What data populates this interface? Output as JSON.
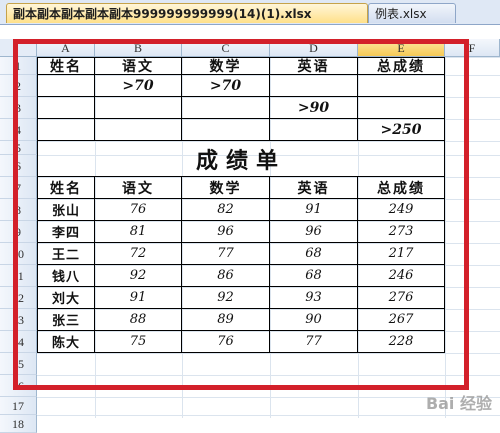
{
  "tabs": [
    {
      "label": "副本副本副本副本副本999999999999(14)(1).xlsx",
      "active": true
    },
    {
      "label": "例表.xlsx",
      "active": false
    }
  ],
  "columns": [
    "A",
    "B",
    "C",
    "D",
    "E",
    "F"
  ],
  "selected_column": "E",
  "rows": [
    "1",
    "2",
    "3",
    "4",
    "5",
    "6",
    "7",
    "8",
    "9",
    "10",
    "11",
    "12",
    "13",
    "14",
    "15",
    "16",
    "17",
    "18"
  ],
  "criteria": {
    "headers": [
      "姓名",
      "语文",
      "数学",
      "英语",
      "总成绩"
    ],
    "row2": [
      "",
      ">70",
      ">70",
      "",
      ""
    ],
    "row3": [
      "",
      "",
      "",
      ">90",
      ""
    ],
    "row4": [
      "",
      "",
      "",
      "",
      ">250"
    ]
  },
  "report": {
    "title": "成绩单",
    "headers": [
      "姓名",
      "语文",
      "数学",
      "英语",
      "总成绩"
    ],
    "records": [
      [
        "张山",
        "76",
        "82",
        "91",
        "249"
      ],
      [
        "李四",
        "81",
        "96",
        "96",
        "273"
      ],
      [
        "王二",
        "72",
        "77",
        "68",
        "217"
      ],
      [
        "钱八",
        "92",
        "86",
        "68",
        "246"
      ],
      [
        "刘大",
        "91",
        "92",
        "93",
        "276"
      ],
      [
        "张三",
        "88",
        "89",
        "90",
        "267"
      ],
      [
        "陈大",
        "75",
        "76",
        "77",
        "228"
      ]
    ]
  },
  "watermark": "Bai 经验",
  "colors": {
    "highlight_frame": "#d3202a",
    "active_tab": "#ffe08a"
  }
}
